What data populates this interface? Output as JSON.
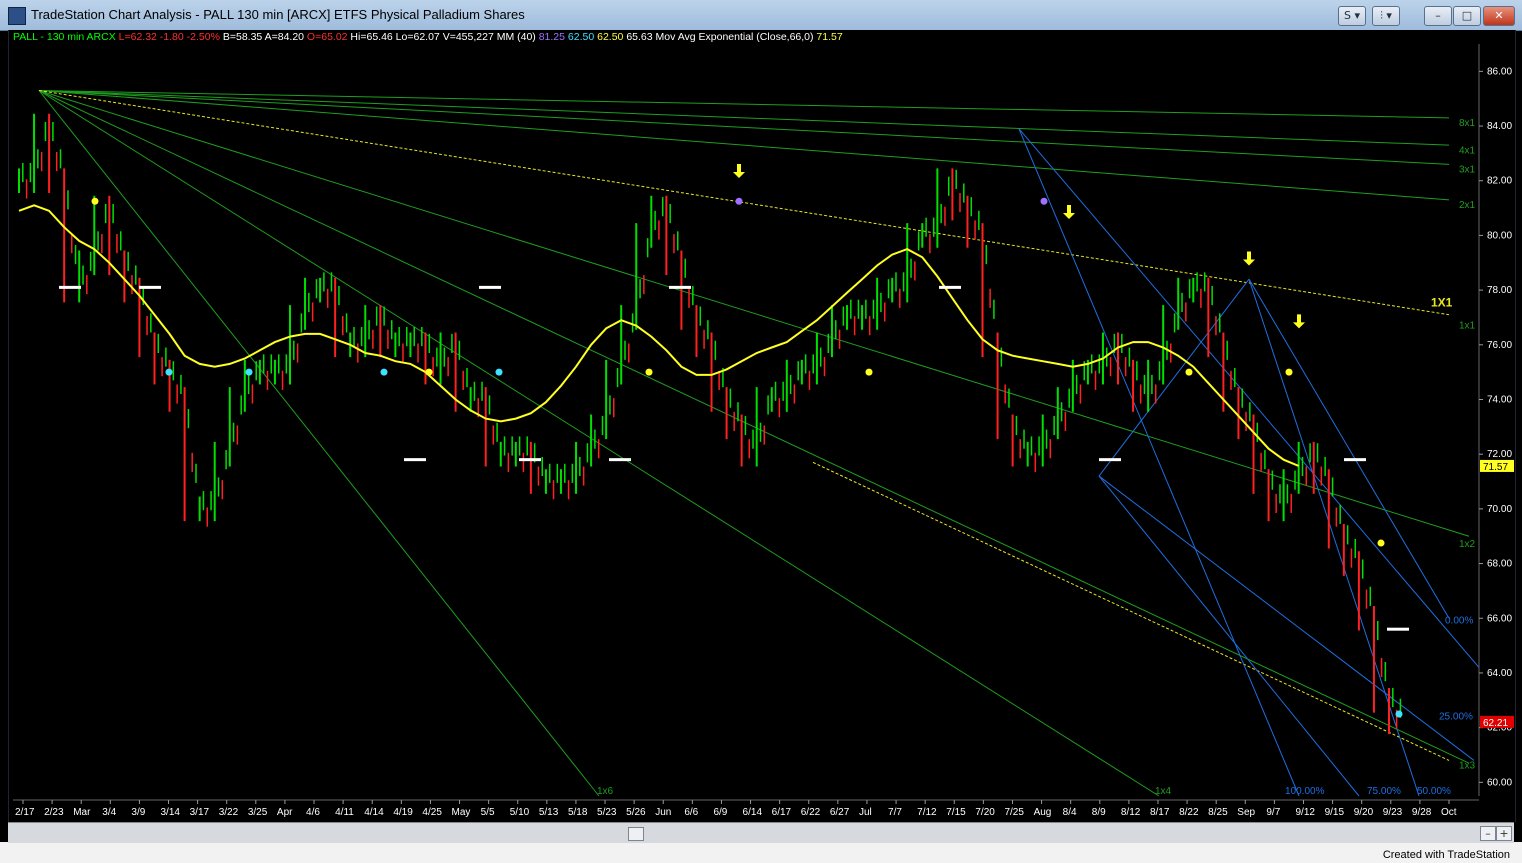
{
  "window": {
    "title": "TradeStation Chart Analysis - PALL 130 min [ARCX] ETFS Physical Palladium Shares",
    "s_button": "S ▾",
    "tools_button": "⫶ ▾",
    "minimize": "–",
    "maximize": "□",
    "close": "✕"
  },
  "status": {
    "credit": "Created with TradeStation",
    "zoom_in": "+",
    "zoom_out": "–"
  },
  "header": {
    "parts": [
      {
        "text": "PALL - 130 min  ARCX",
        "color": "#00ff00"
      },
      {
        "text": "L=62.32",
        "color": "#ff3030"
      },
      {
        "text": "-1.80",
        "color": "#ff3030"
      },
      {
        "text": "-2.50%",
        "color": "#ff3030"
      },
      {
        "text": "B=58.35",
        "color": "#ffffff"
      },
      {
        "text": "A=84.20",
        "color": "#ffffff"
      },
      {
        "text": "O=65.02",
        "color": "#ff3030"
      },
      {
        "text": "Hi=65.46",
        "color": "#ffffff"
      },
      {
        "text": "Lo=62.07",
        "color": "#ffffff"
      },
      {
        "text": "V=455,227",
        "color": "#ffffff"
      },
      {
        "text": "MM (40)",
        "color": "#ffffff"
      },
      {
        "text": "81.25",
        "color": "#a070ff"
      },
      {
        "text": "62.50",
        "color": "#40e0ff"
      },
      {
        "text": "62.50",
        "color": "#ffff40"
      },
      {
        "text": "65.63",
        "color": "#ffffff"
      },
      {
        "text": "Mov Avg Exponential (Close,66,0)",
        "color": "#ffffff"
      },
      {
        "text": "71.57",
        "color": "#ffff40"
      }
    ]
  },
  "colors": {
    "up": "#00e000",
    "down": "#ff2020",
    "ema": "#ffff20",
    "gann": "#1f9e1f",
    "pitchfork": "#1e6fe0",
    "trend": "#e8e820",
    "axis_text": "#ffffff"
  },
  "gann_labels": [
    "8x1",
    "4x1",
    "3x1",
    "2x1",
    "1X1",
    "1x1",
    "1x2",
    "1x3",
    "1x4",
    "1x6"
  ],
  "fib_labels": [
    "0.00%",
    "25.00%",
    "50.00%",
    "75.00%",
    "100.00%"
  ],
  "price_tags": [
    {
      "value": "71.57",
      "bg": "#ffff20",
      "fg": "#000000"
    },
    {
      "value": "62.21",
      "bg": "#e00000",
      "fg": "#ffffff"
    }
  ],
  "chart_data": {
    "type": "line",
    "title": "PALL - 130 min",
    "ylim": [
      59.5,
      87
    ],
    "y_ticks": [
      "86.00",
      "84.00",
      "82.00",
      "80.00",
      "78.00",
      "76.00",
      "74.00",
      "72.00",
      "70.00",
      "68.00",
      "66.00",
      "64.00",
      "62.00",
      "60.00"
    ],
    "x_ticks": [
      "2/17",
      "2/23",
      "Mar",
      "3/4",
      "3/9",
      "3/14",
      "3/17",
      "3/22",
      "3/25",
      "Apr",
      "4/6",
      "4/11",
      "4/14",
      "4/19",
      "4/25",
      "May",
      "5/5",
      "5/10",
      "5/13",
      "5/18",
      "5/23",
      "5/26",
      "Jun",
      "6/6",
      "6/9",
      "6/14",
      "6/17",
      "6/22",
      "6/27",
      "Jul",
      "7/7",
      "7/12",
      "7/15",
      "7/20",
      "7/25",
      "Aug",
      "8/4",
      "8/9",
      "8/12",
      "8/17",
      "8/22",
      "8/25",
      "Sep",
      "9/7",
      "9/12",
      "9/15",
      "9/20",
      "9/23",
      "9/28",
      "Oct"
    ],
    "series": [
      {
        "name": "PALL",
        "values": [
          82,
          84,
          82,
          78,
          79,
          81,
          79,
          78,
          76,
          75,
          74,
          70,
          70,
          72,
          74,
          75,
          75,
          75,
          77,
          78,
          78,
          76,
          76,
          77,
          76,
          76,
          76,
          75,
          76,
          74,
          74,
          72,
          72,
          72,
          71,
          71,
          71,
          72,
          73,
          75,
          77,
          80,
          81,
          79,
          77,
          76,
          74,
          73,
          72,
          74,
          74,
          75,
          75,
          76,
          77,
          77,
          77,
          78,
          78,
          80,
          80,
          82,
          81,
          80,
          76,
          73,
          72,
          72,
          73,
          74,
          75,
          75,
          76,
          75,
          74,
          75,
          77,
          78,
          78,
          76,
          74,
          73,
          71,
          70,
          71,
          72,
          71,
          69,
          68,
          66,
          63,
          62.21
        ]
      },
      {
        "name": "Mov Avg Exponential (Close,66,0)",
        "values": [
          80.9,
          81.1,
          80.9,
          80.3,
          79.8,
          79.5,
          79.0,
          78.4,
          77.8,
          77.1,
          76.4,
          75.6,
          75.3,
          75.2,
          75.3,
          75.5,
          75.8,
          76.1,
          76.3,
          76.4,
          76.4,
          76.2,
          76.0,
          75.7,
          75.6,
          75.4,
          75.3,
          75.0,
          74.5,
          74.0,
          73.6,
          73.3,
          73.2,
          73.3,
          73.5,
          73.9,
          74.5,
          75.2,
          76.0,
          76.6,
          76.9,
          76.7,
          76.3,
          75.8,
          75.2,
          74.9,
          74.9,
          75.1,
          75.4,
          75.7,
          75.9,
          76.1,
          76.5,
          76.9,
          77.4,
          77.9,
          78.4,
          78.9,
          79.3,
          79.5,
          79.2,
          78.5,
          77.7,
          76.9,
          76.2,
          75.8,
          75.6,
          75.5,
          75.4,
          75.3,
          75.2,
          75.3,
          75.5,
          75.9,
          76.1,
          76.1,
          75.9,
          75.6,
          75.2,
          74.6,
          74.0,
          73.4,
          72.8,
          72.2,
          71.8,
          71.57
        ]
      }
    ]
  }
}
